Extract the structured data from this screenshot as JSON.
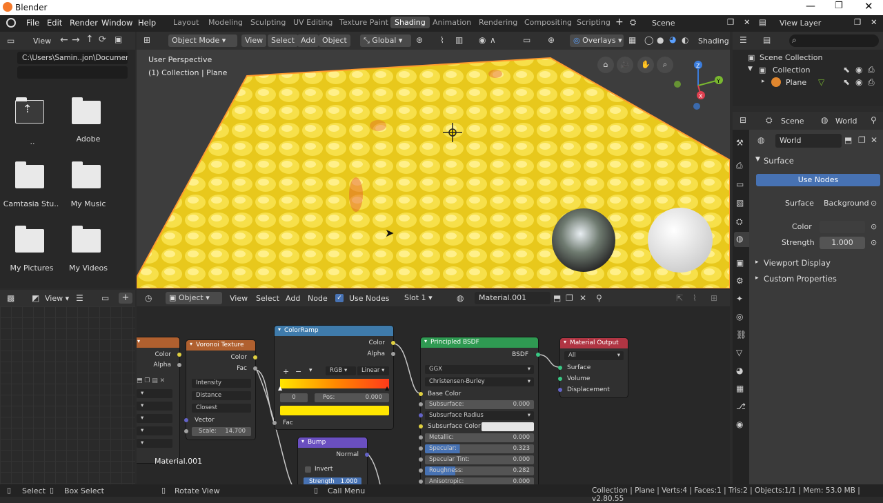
{
  "app": {
    "title": "Blender"
  },
  "menu": [
    "File",
    "Edit",
    "Render",
    "Window",
    "Help"
  ],
  "workspaces": [
    "Layout",
    "Modeling",
    "Sculpting",
    "UV Editing",
    "Texture Paint",
    "Shading",
    "Animation",
    "Rendering",
    "Compositing",
    "Scripting"
  ],
  "active_workspace": "Shading",
  "scene": {
    "name": "Scene",
    "view_layer": "View Layer"
  },
  "file_browser": {
    "view_label": "View",
    "path": "C:\\Users\\Samin..jon\\Documents\\",
    "items": [
      {
        "label": "..",
        "icon": "parent-folder-icon"
      },
      {
        "label": "Adobe",
        "icon": "folder-icon"
      },
      {
        "label": "Camtasia Stu..",
        "icon": "folder-icon"
      },
      {
        "label": "My Music",
        "icon": "folder-icon"
      },
      {
        "label": "My Pictures",
        "icon": "folder-icon"
      },
      {
        "label": "My Videos",
        "icon": "folder-icon"
      }
    ]
  },
  "viewport": {
    "mode": "Object Mode",
    "menus": [
      "View",
      "Select",
      "Add",
      "Object"
    ],
    "transform": "Global",
    "overlays": "Overlays",
    "shading": "Shading",
    "perspective": "User Perspective",
    "collection_info": "(1) Collection | Plane",
    "colors": {
      "plane": "#e6c61a",
      "outline": "#ff9a2e",
      "bg": "#3d3d3d"
    }
  },
  "outliner": {
    "root": "Scene Collection",
    "collection": "Collection",
    "object": "Plane"
  },
  "properties": {
    "tabs": [
      "Scene",
      "World"
    ],
    "world_name": "World",
    "section": "Surface",
    "use_nodes": "Use Nodes",
    "surface_label": "Surface",
    "surface_value": "Background",
    "color_label": "Color",
    "strength_label": "Strength",
    "strength_value": "1.000",
    "collapsed": [
      "Viewport Display",
      "Custom Properties"
    ]
  },
  "node_editor": {
    "object_mode": "Object",
    "menus": [
      "View",
      "Select",
      "Add",
      "Node"
    ],
    "use_nodes": "Use Nodes",
    "slot": "Slot 1",
    "material": "Material.001",
    "material_label": "Material.001",
    "image_node": {
      "outputs": [
        "Color",
        "Alpha"
      ]
    },
    "voronoi": {
      "title": "Voronoi Texture",
      "outputs": [
        "Color",
        "Fac"
      ],
      "options": [
        "Intensity",
        "Distance",
        "Closest"
      ],
      "input": "Vector",
      "scale_label": "Scale:",
      "scale_value": "14.700"
    },
    "colorramp": {
      "title": "ColorRamp",
      "outputs": [
        "Color",
        "Alpha"
      ],
      "mode": "RGB",
      "interp": "Linear",
      "index": "0",
      "pos_label": "Pos:",
      "pos_value": "0.000",
      "input": "Fac"
    },
    "bump": {
      "title": "Bump",
      "output": "Normal",
      "invert": "Invert",
      "strength_label": "Strength",
      "strength_value": "1.000"
    },
    "principled": {
      "title": "Principled BSDF",
      "output": "BSDF",
      "distribution": "GGX",
      "subsurface_method": "Christensen-Burley",
      "base_color": "Base Color",
      "fields": [
        {
          "label": "Subsurface:",
          "value": "0.000"
        },
        {
          "label": "Subsurface Radius",
          "value": ""
        },
        {
          "label": "Subsurface Color",
          "value": ""
        },
        {
          "label": "Metallic:",
          "value": "0.000"
        },
        {
          "label": "Specular:",
          "value": "0.323"
        },
        {
          "label": "Specular Tint:",
          "value": "0.000"
        },
        {
          "label": "Roughness:",
          "value": "0.282"
        },
        {
          "label": "Anisotropic:",
          "value": "0.000"
        }
      ]
    },
    "output": {
      "title": "Material Output",
      "target": "All",
      "inputs": [
        "Surface",
        "Volume",
        "Displacement"
      ]
    }
  },
  "status": {
    "select": "Select",
    "box_select": "Box Select",
    "rotate_view": "Rotate View",
    "call_menu": "Call Menu",
    "info": "Collection | Plane | Verts:4 | Faces:1 | Tris:2 | Objects:1/1 | Mem: 53.0 MB | v2.80.55"
  }
}
